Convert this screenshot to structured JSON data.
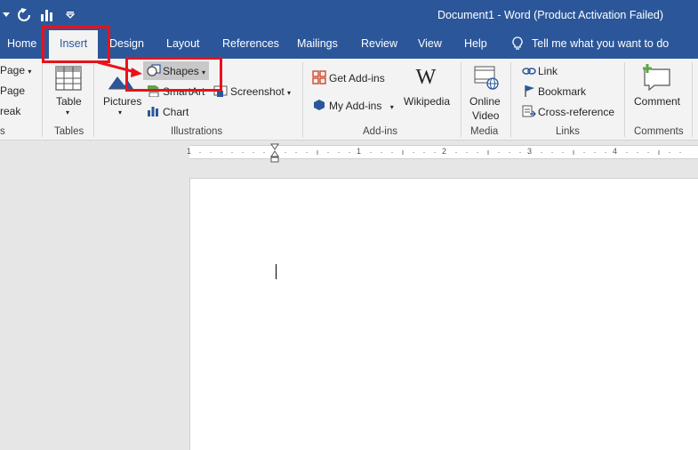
{
  "titlebar": {
    "document_title": "Document1  -  Word (Product Activation Failed)"
  },
  "tabs": [
    {
      "label": "Home"
    },
    {
      "label": "Insert"
    },
    {
      "label": "Design"
    },
    {
      "label": "Layout"
    },
    {
      "label": "References"
    },
    {
      "label": "Mailings"
    },
    {
      "label": "Review"
    },
    {
      "label": "View"
    },
    {
      "label": "Help"
    }
  ],
  "active_tab": "Insert",
  "tell_me": "Tell me what you want to do",
  "ribbon": {
    "pages_group": {
      "items": [
        "Page",
        "Page",
        "reak"
      ],
      "label": "s"
    },
    "tables_group": {
      "table_button": "Table",
      "label": "Tables"
    },
    "illustrations_group": {
      "pictures": "Pictures",
      "shapes": "Shapes",
      "smartart": "SmartArt",
      "chart": "Chart",
      "screenshot": "Screenshot",
      "label": "Illustrations"
    },
    "addins_group": {
      "get_addins": "Get Add-ins",
      "my_addins": "My Add-ins",
      "wikipedia": "Wikipedia",
      "label": "Add-ins"
    },
    "media_group": {
      "online_video_line1": "Online",
      "online_video_line2": "Video",
      "label": "Media"
    },
    "links_group": {
      "link": "Link",
      "bookmark": "Bookmark",
      "cross_reference": "Cross-reference",
      "label": "Links"
    },
    "comments_group": {
      "comment": "Comment",
      "label": "Comments"
    }
  },
  "ruler": {
    "numbers": [
      "1",
      "1",
      "2",
      "3",
      "4"
    ]
  },
  "colors": {
    "brand_blue": "#2b579a",
    "annotation_red": "#e8121b"
  }
}
